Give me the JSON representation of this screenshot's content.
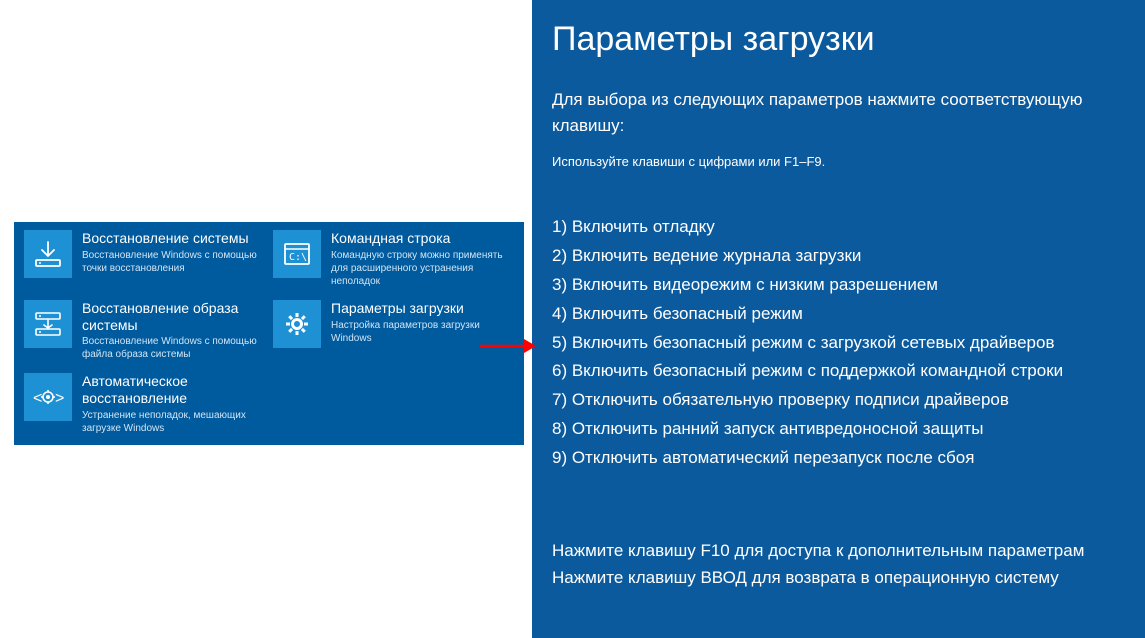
{
  "tiles": [
    {
      "title": "Восстановление системы",
      "desc": "Восстановление Windows с помощью точки восстановления"
    },
    {
      "title": "Командная строка",
      "desc": "Командную строку можно применять для расширенного устранения неполадок"
    },
    {
      "title": "Восстановление образа системы",
      "desc": "Восстановление Windows с помощью файла образа системы"
    },
    {
      "title": "Параметры загрузки",
      "desc": "Настройка параметров загрузки Windows"
    },
    {
      "title": "Автоматическое восстановление",
      "desc": "Устранение неполадок, мешающих загрузке Windows"
    }
  ],
  "right": {
    "title": "Параметры загрузки",
    "subtitle": "Для выбора из следующих параметров нажмите соответствующую клавишу:",
    "hint": "Используйте клавиши с цифрами или F1–F9.",
    "options": [
      "1) Включить отладку",
      "2) Включить ведение журнала загрузки",
      "3) Включить видеорежим с низким разрешением",
      "4) Включить безопасный режим",
      "5) Включить безопасный режим с загрузкой сетевых драйверов",
      "6) Включить безопасный режим с поддержкой командной строки",
      "7) Отключить обязательную проверку подписи драйверов",
      "8) Отключить ранний запуск антивредоносной защиты",
      "9) Отключить автоматический перезапуск после сбоя"
    ],
    "footer1": "Нажмите клавишу F10 для доступа к дополнительным параметрам",
    "footer2": "Нажмите клавишу ВВОД для возврата в операционную систему"
  }
}
